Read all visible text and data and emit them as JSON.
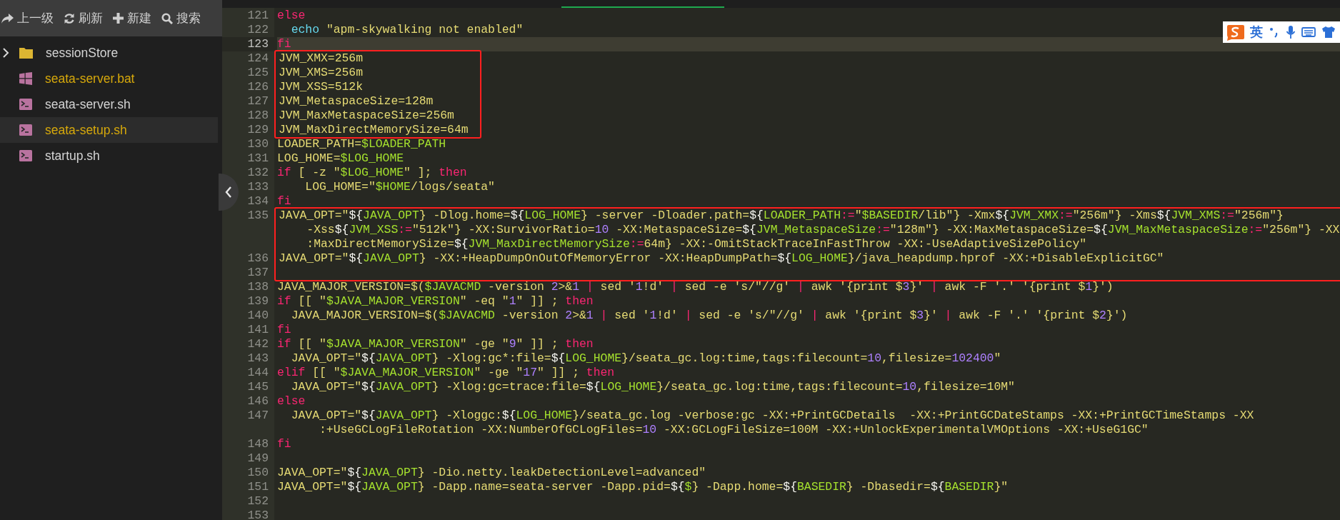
{
  "toolbar": {
    "buttons": [
      {
        "kind": "up",
        "label": "上一级"
      },
      {
        "kind": "refresh",
        "label": "刷新"
      },
      {
        "kind": "new",
        "label": "新建"
      },
      {
        "kind": "search",
        "label": "搜索"
      }
    ]
  },
  "files": [
    {
      "kind": "folder",
      "name": "sessionStore",
      "expanded": false,
      "selected": false,
      "color": "#d4d4d4"
    },
    {
      "kind": "windows",
      "name": "seata-server.bat",
      "selected": false,
      "color": "#d6a80b"
    },
    {
      "kind": "shell",
      "name": "seata-server.sh",
      "selected": false,
      "color": "#d4d4d4"
    },
    {
      "kind": "shell",
      "name": "seata-setup.sh",
      "selected": true,
      "color": "#d6a80b"
    },
    {
      "kind": "shell",
      "name": "startup.sh",
      "selected": false,
      "color": "#d4d4d4"
    }
  ],
  "ime_toolbar": {
    "label": "英"
  },
  "editor": {
    "groups": [
      {
        "highlighted": false,
        "lines": [
          {
            "number": "121",
            "current": false,
            "segments": [
              "else"
            ]
          },
          {
            "number": "122",
            "current": false,
            "segments": [
              "  echo \"apm-skywalking not enabled\""
            ]
          },
          {
            "number": "123",
            "current": true,
            "segments": [
              "fi"
            ]
          }
        ]
      },
      {
        "highlighted": true,
        "lines": [
          {
            "number": "124",
            "current": false,
            "segments": [
              "JVM_XMX=256m"
            ]
          },
          {
            "number": "125",
            "current": false,
            "segments": [
              "JVM_XMS=256m"
            ]
          },
          {
            "number": "126",
            "current": false,
            "segments": [
              "JVM_XSS=512k"
            ]
          },
          {
            "number": "127",
            "current": false,
            "segments": [
              "JVM_MetaspaceSize=128m"
            ]
          },
          {
            "number": "128",
            "current": false,
            "segments": [
              "JVM_MaxMetaspaceSize=256m"
            ]
          },
          {
            "number": "129",
            "current": false,
            "segments": [
              "JVM_MaxDirectMemorySize=64m"
            ]
          }
        ]
      },
      {
        "highlighted": false,
        "lines": [
          {
            "number": "130",
            "current": false,
            "segments": [
              "LOADER_PATH=$LOADER_PATH"
            ]
          },
          {
            "number": "131",
            "current": false,
            "segments": [
              "LOG_HOME=$LOG_HOME"
            ]
          },
          {
            "number": "132",
            "current": false,
            "segments": [
              "if [ -z \"$LOG_HOME\" ]; then"
            ]
          },
          {
            "number": "133",
            "current": false,
            "segments": [
              "    LOG_HOME=\"$HOME/logs/seata\""
            ]
          },
          {
            "number": "134",
            "current": false,
            "segments": [
              "fi"
            ]
          }
        ]
      },
      {
        "highlighted": true,
        "lines": [
          {
            "number": "135",
            "current": false,
            "segments": [
              "JAVA_OPT=\"${JAVA_OPT} -Dlog.home=${LOG_HOME} -server -Dloader.path=${LOADER_PATH:=\"$BASEDIR/lib\"} -Xmx${JVM_XMX:=\"256m\"} -Xms${JVM_XMS:=\"256m\"}",
              "    -Xss${JVM_XSS:=\"512k\"} -XX:SurvivorRatio=10 -XX:MetaspaceSize=${JVM_MetaspaceSize:=\"128m\"} -XX:MaxMetaspaceSize=${JVM_MaxMetaspaceSize:=\"256m\"} -XX",
              "    :MaxDirectMemorySize=${JVM_MaxDirectMemorySize:=64m} -XX:-OmitStackTraceInFastThrow -XX:-UseAdaptiveSizePolicy\""
            ]
          },
          {
            "number": "136",
            "current": false,
            "segments": [
              "JAVA_OPT=\"${JAVA_OPT} -XX:+HeapDumpOnOutOfMemoryError -XX:HeapDumpPath=${LOG_HOME}/java_heapdump.hprof -XX:+DisableExplicitGC\""
            ]
          },
          {
            "number": "137",
            "current": false
          }
        ]
      },
      {
        "highlighted": false,
        "lines": [
          {
            "number": "138",
            "current": false,
            "segments": [
              "JAVA_MAJOR_VERSION=$($JAVACMD -version 2>&1 | sed '1!d' | sed -e 's/\"//g' | awk '{print $3}' | awk -F '.' '{print $1}')"
            ]
          },
          {
            "number": "139",
            "current": false,
            "segments": [
              "if [[ \"$JAVA_MAJOR_VERSION\" -eq \"1\" ]] ; then"
            ]
          },
          {
            "number": "140",
            "current": false,
            "segments": [
              "  JAVA_MAJOR_VERSION=$($JAVACMD -version 2>&1 | sed '1!d' | sed -e 's/\"//g' | awk '{print $3}' | awk -F '.' '{print $2}')"
            ]
          },
          {
            "number": "141",
            "current": false,
            "segments": [
              "fi"
            ]
          },
          {
            "number": "142",
            "current": false,
            "segments": [
              "if [[ \"$JAVA_MAJOR_VERSION\" -ge \"9\" ]] ; then"
            ]
          },
          {
            "number": "143",
            "current": false,
            "segments": [
              "  JAVA_OPT=\"${JAVA_OPT} -Xlog:gc*:file=${LOG_HOME}/seata_gc.log:time,tags:filecount=10,filesize=102400\""
            ]
          },
          {
            "number": "144",
            "current": false,
            "segments": [
              "elif [[ \"$JAVA_MAJOR_VERSION\" -ge \"17\" ]] ; then"
            ]
          },
          {
            "number": "145",
            "current": false,
            "segments": [
              "  JAVA_OPT=\"${JAVA_OPT} -Xlog:gc=trace:file=${LOG_HOME}/seata_gc.log:time,tags:filecount=10,filesize=10M\""
            ]
          },
          {
            "number": "146",
            "current": false,
            "segments": [
              "else"
            ]
          },
          {
            "number": "147",
            "current": false,
            "segments": [
              "  JAVA_OPT=\"${JAVA_OPT} -Xloggc:${LOG_HOME}/seata_gc.log -verbose:gc -XX:+PrintGCDetails  -XX:+PrintGCDateStamps -XX:+PrintGCTimeStamps -XX",
              "      :+UseGCLogFileRotation -XX:NumberOfGCLogFiles=10 -XX:GCLogFileSize=100M -XX:+UnlockExperimentalVMOptions -XX:+UseG1GC\""
            ]
          },
          {
            "number": "148",
            "current": false,
            "segments": [
              "fi"
            ]
          },
          {
            "number": "149",
            "current": false
          },
          {
            "number": "150",
            "current": false,
            "segments": [
              "JAVA_OPT=\"${JAVA_OPT} -Dio.netty.leakDetectionLevel=advanced\""
            ]
          },
          {
            "number": "151",
            "current": false,
            "segments": [
              "JAVA_OPT=\"${JAVA_OPT} -Dapp.name=seata-server -Dapp.pid=${$} -Dapp.home=${BASEDIR} -Dbasedir=${BASEDIR}\""
            ]
          },
          {
            "number": "152",
            "current": false
          },
          {
            "number": "153",
            "current": false
          }
        ]
      }
    ]
  }
}
